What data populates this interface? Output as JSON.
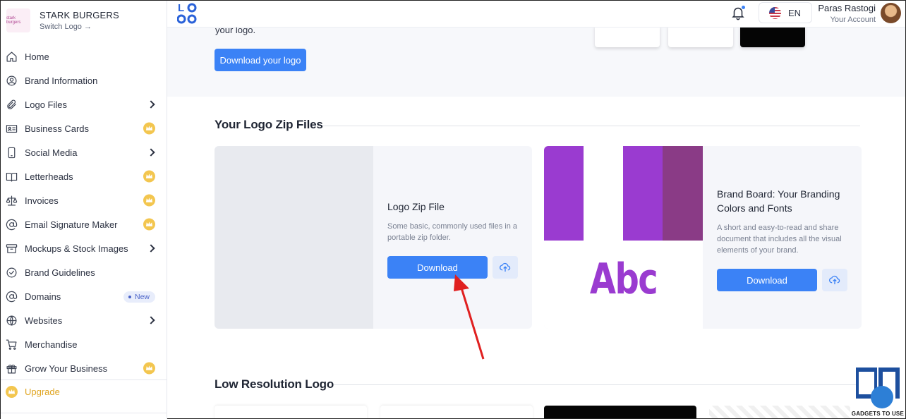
{
  "brand": {
    "name": "STARK BURGERS",
    "switch_label": "Switch Logo →",
    "thumb_text": "stark burgers"
  },
  "sidebar": {
    "items": [
      {
        "label": "Home",
        "icon": "home-icon",
        "right": ""
      },
      {
        "label": "Brand Information",
        "icon": "user-circle-icon",
        "right": ""
      },
      {
        "label": "Logo Files",
        "icon": "paperclip-icon",
        "right": "chevron"
      },
      {
        "label": "Business Cards",
        "icon": "id-card-icon",
        "right": "crown"
      },
      {
        "label": "Social Media",
        "icon": "phone-icon",
        "right": "chevron"
      },
      {
        "label": "Letterheads",
        "icon": "book-icon",
        "right": "crown"
      },
      {
        "label": "Invoices",
        "icon": "scale-icon",
        "right": "crown"
      },
      {
        "label": "Email Signature Maker",
        "icon": "at-icon",
        "right": "crown"
      },
      {
        "label": "Mockups & Stock Images",
        "icon": "box-icon",
        "right": "chevron"
      },
      {
        "label": "Brand Guidelines",
        "icon": "check-circle-icon",
        "right": ""
      },
      {
        "label": "Domains",
        "icon": "at-icon",
        "right": "new"
      },
      {
        "label": "Websites",
        "icon": "globe-icon",
        "right": "chevron"
      },
      {
        "label": "Merchandise",
        "icon": "cart-icon",
        "right": ""
      },
      {
        "label": "Grow Your Business",
        "icon": "gift-icon",
        "right": "crown"
      }
    ],
    "new_badge": "New",
    "upgrade_label": "Upgrade"
  },
  "header": {
    "logo_text": "LO GO",
    "lang_code": "EN",
    "account_name": "Paras Rastogi",
    "account_sub": "Your Account"
  },
  "main": {
    "top_text": "your logo.",
    "download_logo_label": "Download your logo",
    "zip_section_title": "Your Logo Zip Files",
    "zip_card": {
      "title": "Logo Zip File",
      "desc": "Some basic, commonly used files in a portable zip folder.",
      "download_label": "Download"
    },
    "board_card": {
      "title": "Brand Board: Your Branding Colors and Fonts",
      "desc": "A short and easy-to-read and share document that includes all the visual elements of your brand.",
      "download_label": "Download",
      "sample_text": "Abc"
    },
    "low_res_title": "Low Resolution Logo"
  },
  "watermark": {
    "text": "GADGETS TO USE"
  },
  "colors": {
    "accent": "#3b82f6",
    "purple": "#9a3bd0",
    "dark_purple": "#8a3b86",
    "crown": "#f3c64f",
    "arrow": "#e02020"
  }
}
